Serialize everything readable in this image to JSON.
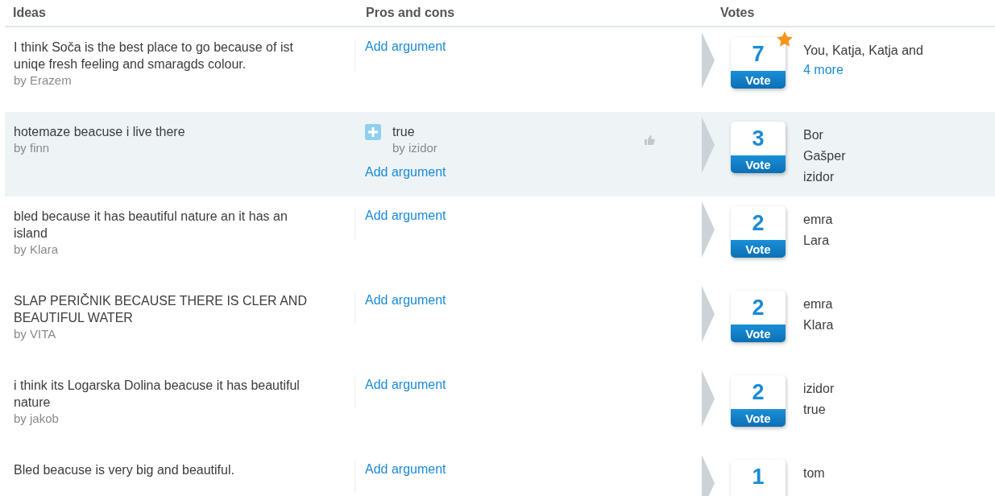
{
  "columns": [
    "Ideas",
    "Pros and cons",
    "Votes"
  ],
  "ideas": [
    {
      "text": "I think Soča is the best place to go because of ist uniqe fresh feeling and smaragds colour.",
      "author": "by Erazem",
      "highlighted": false,
      "add_argument": "Add argument",
      "votes": "7",
      "vote_button": "Vote",
      "starred": true,
      "voters": [
        "You, Katja, Katja and"
      ],
      "more_link": "4 more"
    },
    {
      "text": "hotemaze beacuse i live there",
      "author": "by finn",
      "highlighted": true,
      "arguments": [
        {
          "kind": "pro",
          "text": "true",
          "author": "by izidor"
        }
      ],
      "add_argument": "Add argument",
      "votes": "3",
      "vote_button": "Vote",
      "starred": false,
      "voters": [
        "Bor",
        "Gašper",
        "izidor"
      ]
    },
    {
      "text": "bled because it has beautiful nature an it has an island",
      "author": "by Klara",
      "highlighted": false,
      "add_argument": "Add argument",
      "votes": "2",
      "vote_button": "Vote",
      "starred": false,
      "voters": [
        "emra",
        "Lara"
      ]
    },
    {
      "text": "SLAP PERIČNIK BECAUSE THERE IS CLER AND BEAUTIFUL WATER",
      "author": "by VITA",
      "highlighted": false,
      "add_argument": "Add argument",
      "votes": "2",
      "vote_button": "Vote",
      "starred": false,
      "voters": [
        "emra",
        "Klara"
      ]
    },
    {
      "text": "i think its Logarska Dolina beacuse it has beautiful nature",
      "author": "by jakob",
      "highlighted": false,
      "add_argument": "Add argument",
      "votes": "2",
      "vote_button": "Vote",
      "starred": false,
      "voters": [
        "izidor",
        "true"
      ]
    },
    {
      "text": "Bled beacuse is very big and beautiful.",
      "highlighted": false,
      "add_argument": "Add argument",
      "votes": "1",
      "starred": false,
      "voters": [
        "tom"
      ]
    }
  ]
}
